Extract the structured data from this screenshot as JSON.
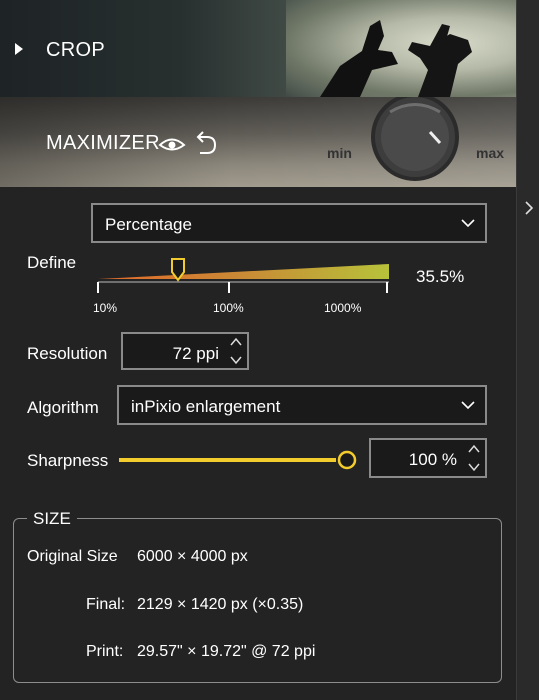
{
  "crop": {
    "title": "CROP"
  },
  "maximizer": {
    "title": "MAXIMIZER",
    "knob_min": "min",
    "knob_max": "max"
  },
  "mode_select": {
    "value": "Percentage"
  },
  "define": {
    "label": "Define",
    "value_text": "35.5%",
    "ticks": [
      "10%",
      "100%",
      "1000%"
    ],
    "slider_fraction": 0.28
  },
  "resolution": {
    "label": "Resolution",
    "value": "72 ppi"
  },
  "algorithm": {
    "label": "Algorithm",
    "value": "inPixio enlargement"
  },
  "sharpness": {
    "label": "Sharpness",
    "value": "100 %",
    "slider_fraction": 1.0
  },
  "size": {
    "legend": "SIZE",
    "original_label": "Original Size",
    "original_value": "6000 × 4000 px",
    "final_label": "Final:",
    "final_value": "2129 × 1420 px (×0.35)",
    "print_label": "Print:",
    "print_value": "29.57\" × 19.72\" @ 72 ppi"
  },
  "colors": {
    "accent_yellow": "#f2cc2c",
    "slider_start": "#e46a2b",
    "slider_end": "#b7c23a"
  }
}
